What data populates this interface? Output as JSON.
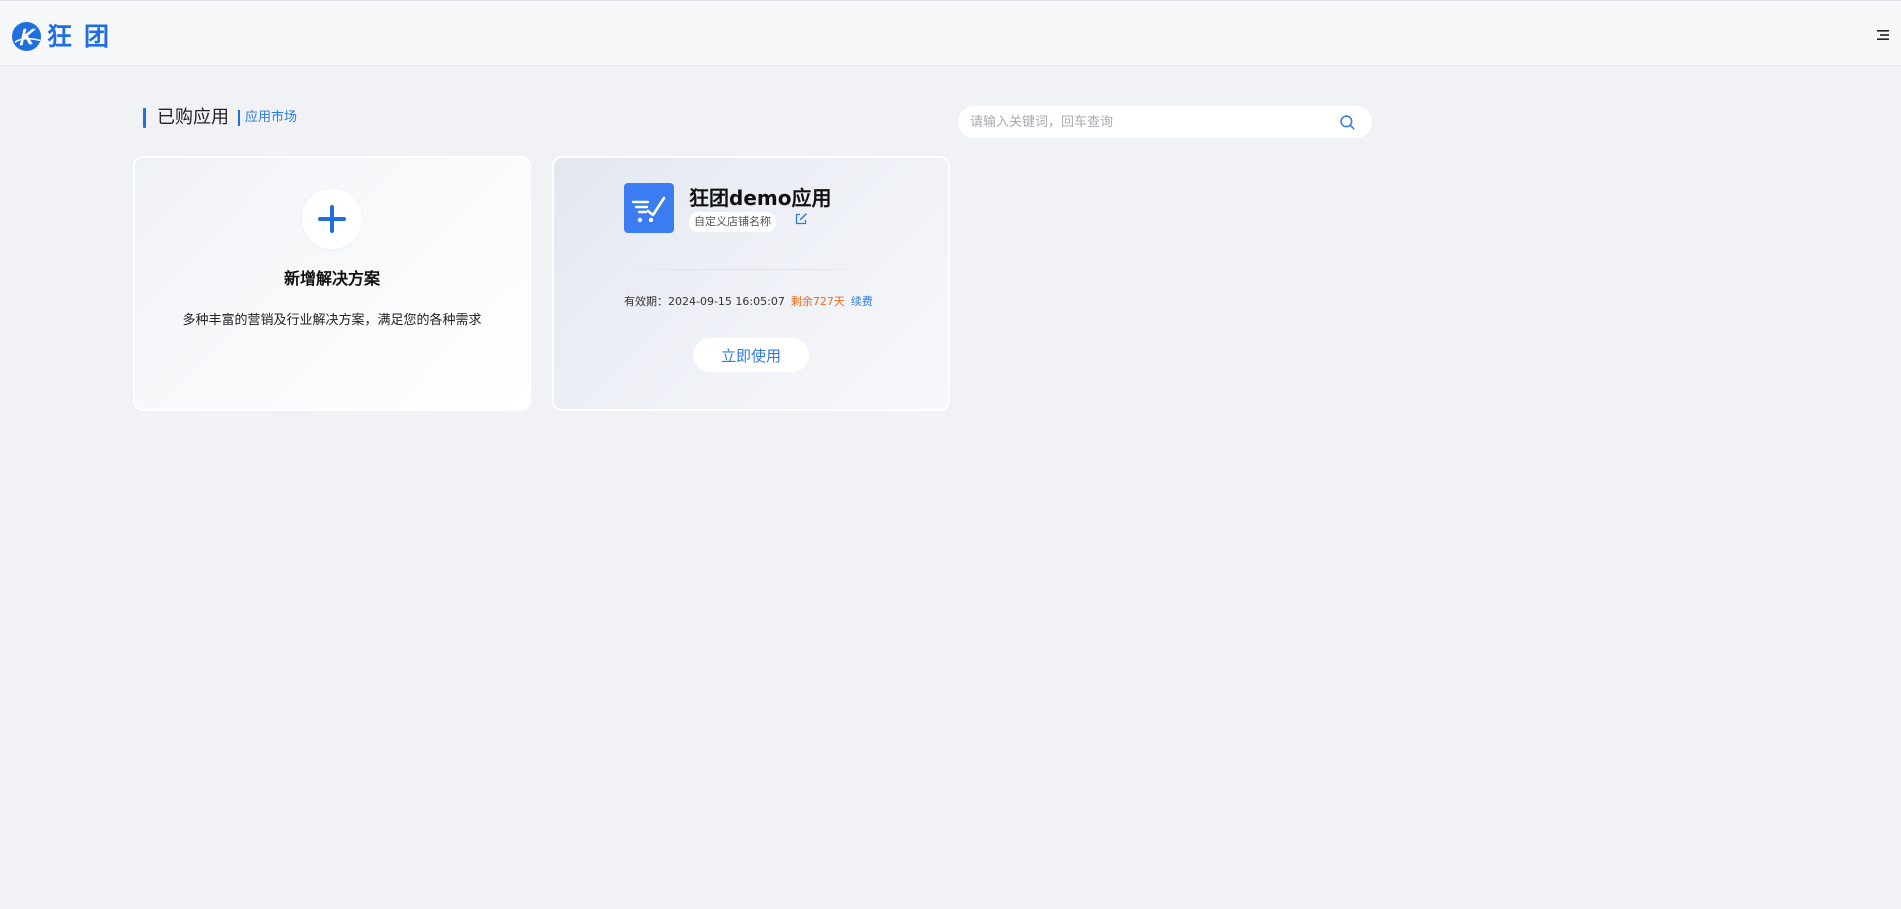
{
  "header": {
    "logo_text": "狂团",
    "brand_color": "#1f6fe0",
    "menu_icon": "hamburger-menu-icon"
  },
  "section": {
    "title": "已购应用",
    "market_link": "应用市场"
  },
  "search": {
    "placeholder": "请输入关键词，回车查询",
    "value": "",
    "icon": "search-icon"
  },
  "add_card": {
    "icon": "plus-icon",
    "title": "新增解决方案",
    "description": "多种丰富的营销及行业解决方案，满足您的各种需求"
  },
  "app_card": {
    "icon": "shopping-cart-icon",
    "icon_color": "#3b7cf2",
    "name": "狂团demo应用",
    "shop_name": "自定义店铺名称",
    "edit_icon": "edit-icon",
    "validity_label": "有效期：",
    "validity_date": "2024-09-15 16:05:07",
    "remaining": "剩余727天",
    "remaining_color": "#ef6a1c",
    "renew": "续费",
    "use_button": "立即使用"
  }
}
